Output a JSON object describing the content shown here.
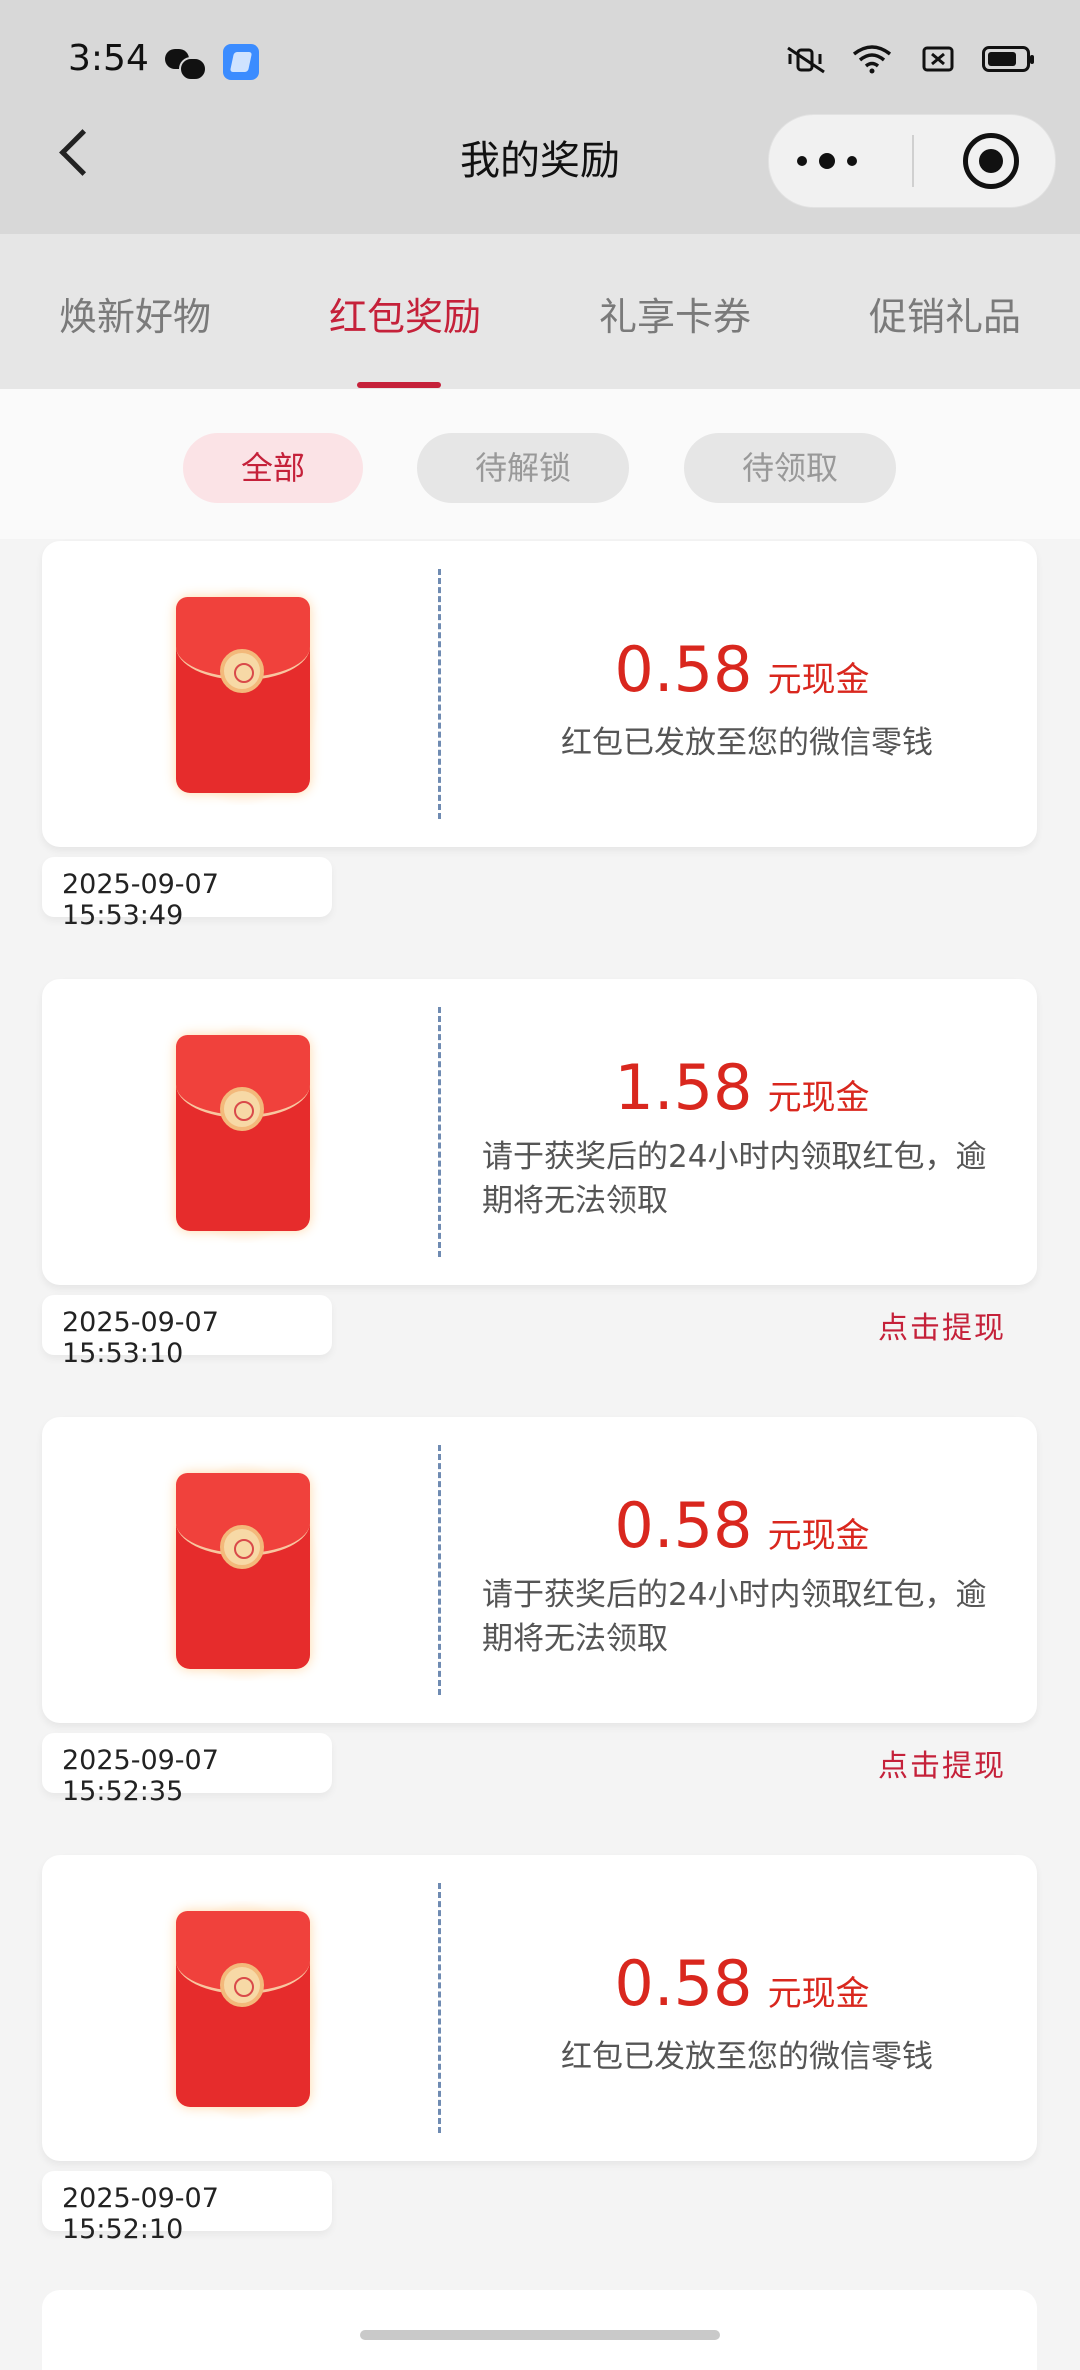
{
  "status_bar": {
    "time": "3:54",
    "left_icons": [
      "wechat-icon",
      "app-icon"
    ],
    "right_icons": [
      "mute-vibrate-icon",
      "wifi-icon",
      "sim-icon",
      "battery-icon"
    ]
  },
  "navbar": {
    "title": "我的奖励",
    "back_icon": "chevron-left-icon",
    "menu_icon": "more-dots-icon",
    "close_icon": "target-icon"
  },
  "tabs": [
    {
      "label": "焕新好物",
      "active": false
    },
    {
      "label": "红包奖励",
      "active": true
    },
    {
      "label": "礼享卡券",
      "active": false
    },
    {
      "label": "促销礼品",
      "active": false
    }
  ],
  "filters": [
    {
      "label": "全部",
      "active": true
    },
    {
      "label": "待解锁",
      "active": false
    },
    {
      "label": "待领取",
      "active": false
    }
  ],
  "rewards": [
    {
      "amount": "0.58",
      "unit": "元现金",
      "description": "红包已发放至您的微信零钱",
      "date": "2025-09-07 15:53:49",
      "action": ""
    },
    {
      "amount": "1.58",
      "unit": "元现金",
      "description": "请于获奖后的24小时内领取红包，逾期将无法领取",
      "date": "2025-09-07 15:53:10",
      "action": "点击提现"
    },
    {
      "amount": "0.58",
      "unit": "元现金",
      "description": "请于获奖后的24小时内领取红包，逾期将无法领取",
      "date": "2025-09-07 15:52:35",
      "action": "点击提现"
    },
    {
      "amount": "0.58",
      "unit": "元现金",
      "description": "红包已发放至您的微信零钱",
      "date": "2025-09-07 15:52:10",
      "action": ""
    }
  ],
  "colors": {
    "accent": "#c5213a",
    "amount": "#d9271e",
    "header_bg": "#d8d8d8"
  }
}
